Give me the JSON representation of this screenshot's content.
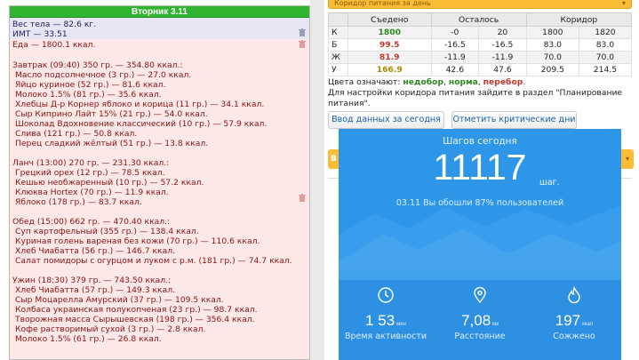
{
  "diary": {
    "day_header": "Вторник 3.11",
    "body_weight": "Вес тела — 82.6 кг.",
    "bmi": "ИМТ — 33.51",
    "food_total": "Еда — 1800.1 ккал.",
    "meals": [
      {
        "title": "Завтрак (09:40) 350 гр. — 354.80 ккал.:",
        "items": [
          "Масло подсолнечное (3 гр.) — 27.0 ккал.",
          "Яйцо куриное (52 гр.) — 81.6 ккал.",
          "Молоко 1.5% (81 гр.) — 35.6 ккал.",
          "Хлебцы Д-р Корнер яблоко и корица (11 гр.) — 34.1 ккал.",
          "Сыр Киприно Лайт 15% (21 гр.) — 54.0 ккал.",
          "Шоколад Вдохновение классический (10 гр.) — 57.9 ккал.",
          "Слива (121 гр.) — 50.8 ккал.",
          "Перец сладкий жёлтый (51 гр.) — 13.8 ккал."
        ]
      },
      {
        "title": "Ланч (13:00) 270 гр. — 231.30 ккал.:",
        "items": [
          "Грецкий орех (12 гр.) — 78.5 ккал.",
          "Кешью необжаренный (10 гр.) — 57.2 ккал.",
          "Клюква Hortex (70 гр.) — 11.9 ккал.",
          "Яблоко (178 гр.) — 83.7 ккал."
        ]
      },
      {
        "title": "Обед (15:00) 662 гр. — 470.40 ккал.:",
        "items": [
          "Суп картофельный (355 гр.) — 138.4 ккал.",
          "Куриная голень вареная без кожи (70 гр.) — 110.6 ккал.",
          "Хлеб Чиабатта (56 гр.) — 146.7 ккал.",
          "Салат помидоры с огурцом и луком с р.м. (181 гр.) — 74.7 ккал."
        ]
      },
      {
        "title": "Ужин (18:30) 379 гр. — 743.50 ккал.:",
        "items": [
          "Хлеб Чиабатта (57 гр.) — 149.3 ккал.",
          "Сыр Моцарелла Амурский (37 гр.) — 109.5 ккал.",
          "Колбаса украинская полукопченая (23 гр.) — 98.7 ккал.",
          "Творожная масса Сырышевская (198 гр.) — 356.4 ккал.",
          "Кофе растворимый сухой (3 гр.) — 2.8 ккал.",
          "Молоко 1.5% (61 гр.) — 26.8 ккал."
        ]
      }
    ]
  },
  "corridor": {
    "bar_label": "Коридор питания за день",
    "headers": [
      "",
      "Съедено",
      "Осталось",
      "",
      "Коридор",
      ""
    ],
    "rows": [
      {
        "letter": "К",
        "eaten": "1800",
        "left_a": "-0",
        "left_b": "20",
        "cor_a": "1800",
        "cor_b": "1820",
        "status": "green"
      },
      {
        "letter": "Б",
        "eaten": "99.5",
        "left_a": "-16.5",
        "left_b": "-16.5",
        "cor_a": "83.0",
        "cor_b": "83.0",
        "status": "red"
      },
      {
        "letter": "Ж",
        "eaten": "81.9",
        "left_a": "-11.9",
        "left_b": "-11.9",
        "cor_a": "70.0",
        "cor_b": "70.0",
        "status": "red"
      },
      {
        "letter": "У",
        "eaten": "166.9",
        "left_a": "42.6",
        "left_b": "47.6",
        "cor_a": "209.5",
        "cor_b": "214.5",
        "status": "orange"
      }
    ],
    "legend_prefix": "Цвета означают: ",
    "legend_under": "недобор",
    "legend_sep1": ", ",
    "legend_norm": "норма",
    "legend_sep2": ", ",
    "legend_over": "перебор",
    "legend_end": ".",
    "settings_note": "Для настройки коридора питания зайдите в раздел \"Планирование питания\".",
    "btn_input": "Ввод данных за сегодня",
    "btn_critical": "Отметить критические дни",
    "yellow_tab": "В"
  },
  "steps": {
    "title": "Шагов сегодня",
    "count": "11117",
    "unit": "шаг.",
    "subtitle": "03.11 Вы обошли 87% пользователей",
    "stats": [
      {
        "value_main": "1",
        "value_mid": "53",
        "unit": "мин",
        "label": "Время активности",
        "icon": "clock-icon"
      },
      {
        "value_main": "7,08",
        "unit": "км",
        "label": "Расстояние",
        "icon": "location-pin-icon"
      },
      {
        "value_main": "197",
        "unit": "ккал",
        "label": "Сожжено",
        "icon": "flame-icon"
      }
    ]
  },
  "colors": {
    "header_green": "#2fb52f",
    "diary_bg": "#fde8e8",
    "steps_blue": "#2d96e8",
    "bar_orange": "#fbbd36"
  }
}
